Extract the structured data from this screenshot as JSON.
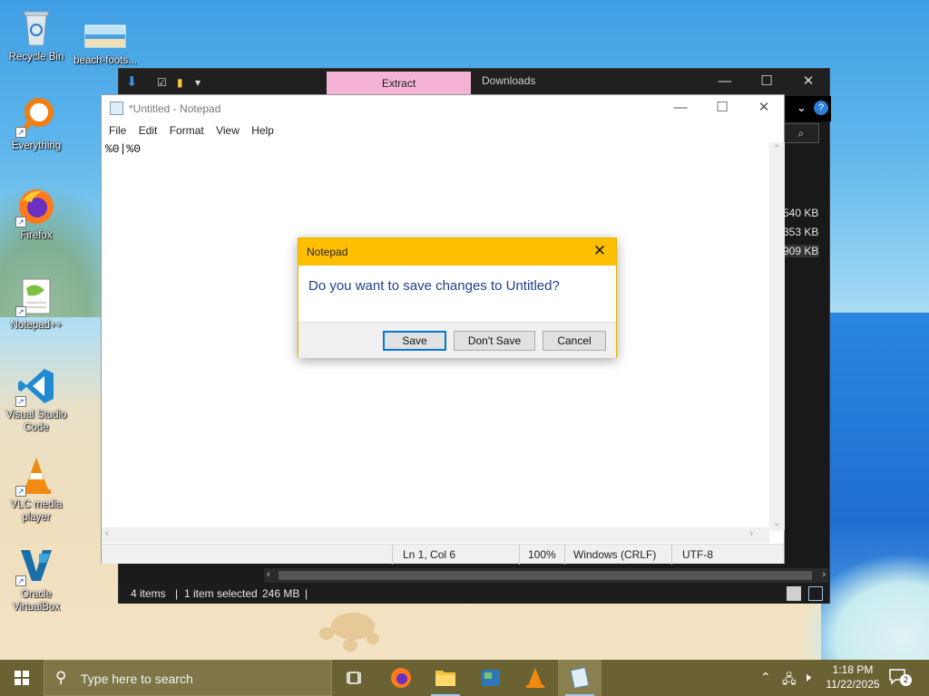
{
  "desktop": {
    "icons": [
      {
        "label": "Recycle Bin",
        "icon": "recycle-bin-icon"
      },
      {
        "label": "beach-foots...",
        "icon": "image-file-icon"
      },
      {
        "label": "Everything",
        "icon": "everything-search-icon"
      },
      {
        "label": "Firefox",
        "icon": "firefox-icon"
      },
      {
        "label": "Notepad++",
        "icon": "notepad-plus-plus-icon"
      },
      {
        "label": "Visual Studio Code",
        "icon": "vscode-icon"
      },
      {
        "label": "VLC media player",
        "icon": "vlc-icon"
      },
      {
        "label": "Oracle VirtualBox",
        "icon": "virtualbox-icon"
      }
    ]
  },
  "explorer": {
    "tabs": [
      "Extract",
      "Downloads"
    ],
    "file_sizes": [
      "540 KB",
      "353 KB",
      "909 KB"
    ],
    "status": {
      "items": "4 items",
      "selected": "1 item selected",
      "size": "246 MB"
    },
    "tab_active_color": "#f4b3d4"
  },
  "notepad": {
    "title": "*Untitled - Notepad",
    "menu": [
      "File",
      "Edit",
      "Format",
      "View",
      "Help"
    ],
    "content": "%0|%0",
    "status": {
      "position": "Ln 1, Col 6",
      "zoom": "100%",
      "line_ending": "Windows (CRLF)",
      "encoding": "UTF-8"
    }
  },
  "dialog": {
    "title": "Notepad",
    "message": "Do you want to save changes to Untitled?",
    "buttons": {
      "save": "Save",
      "dont_save": "Don't Save",
      "cancel": "Cancel"
    },
    "accent": "#ffbf00"
  },
  "taskbar": {
    "search_placeholder": "Type here to search",
    "time": "1:18 PM",
    "date": "11/22/2025",
    "notification_count": "2",
    "color": "#6b6233"
  }
}
